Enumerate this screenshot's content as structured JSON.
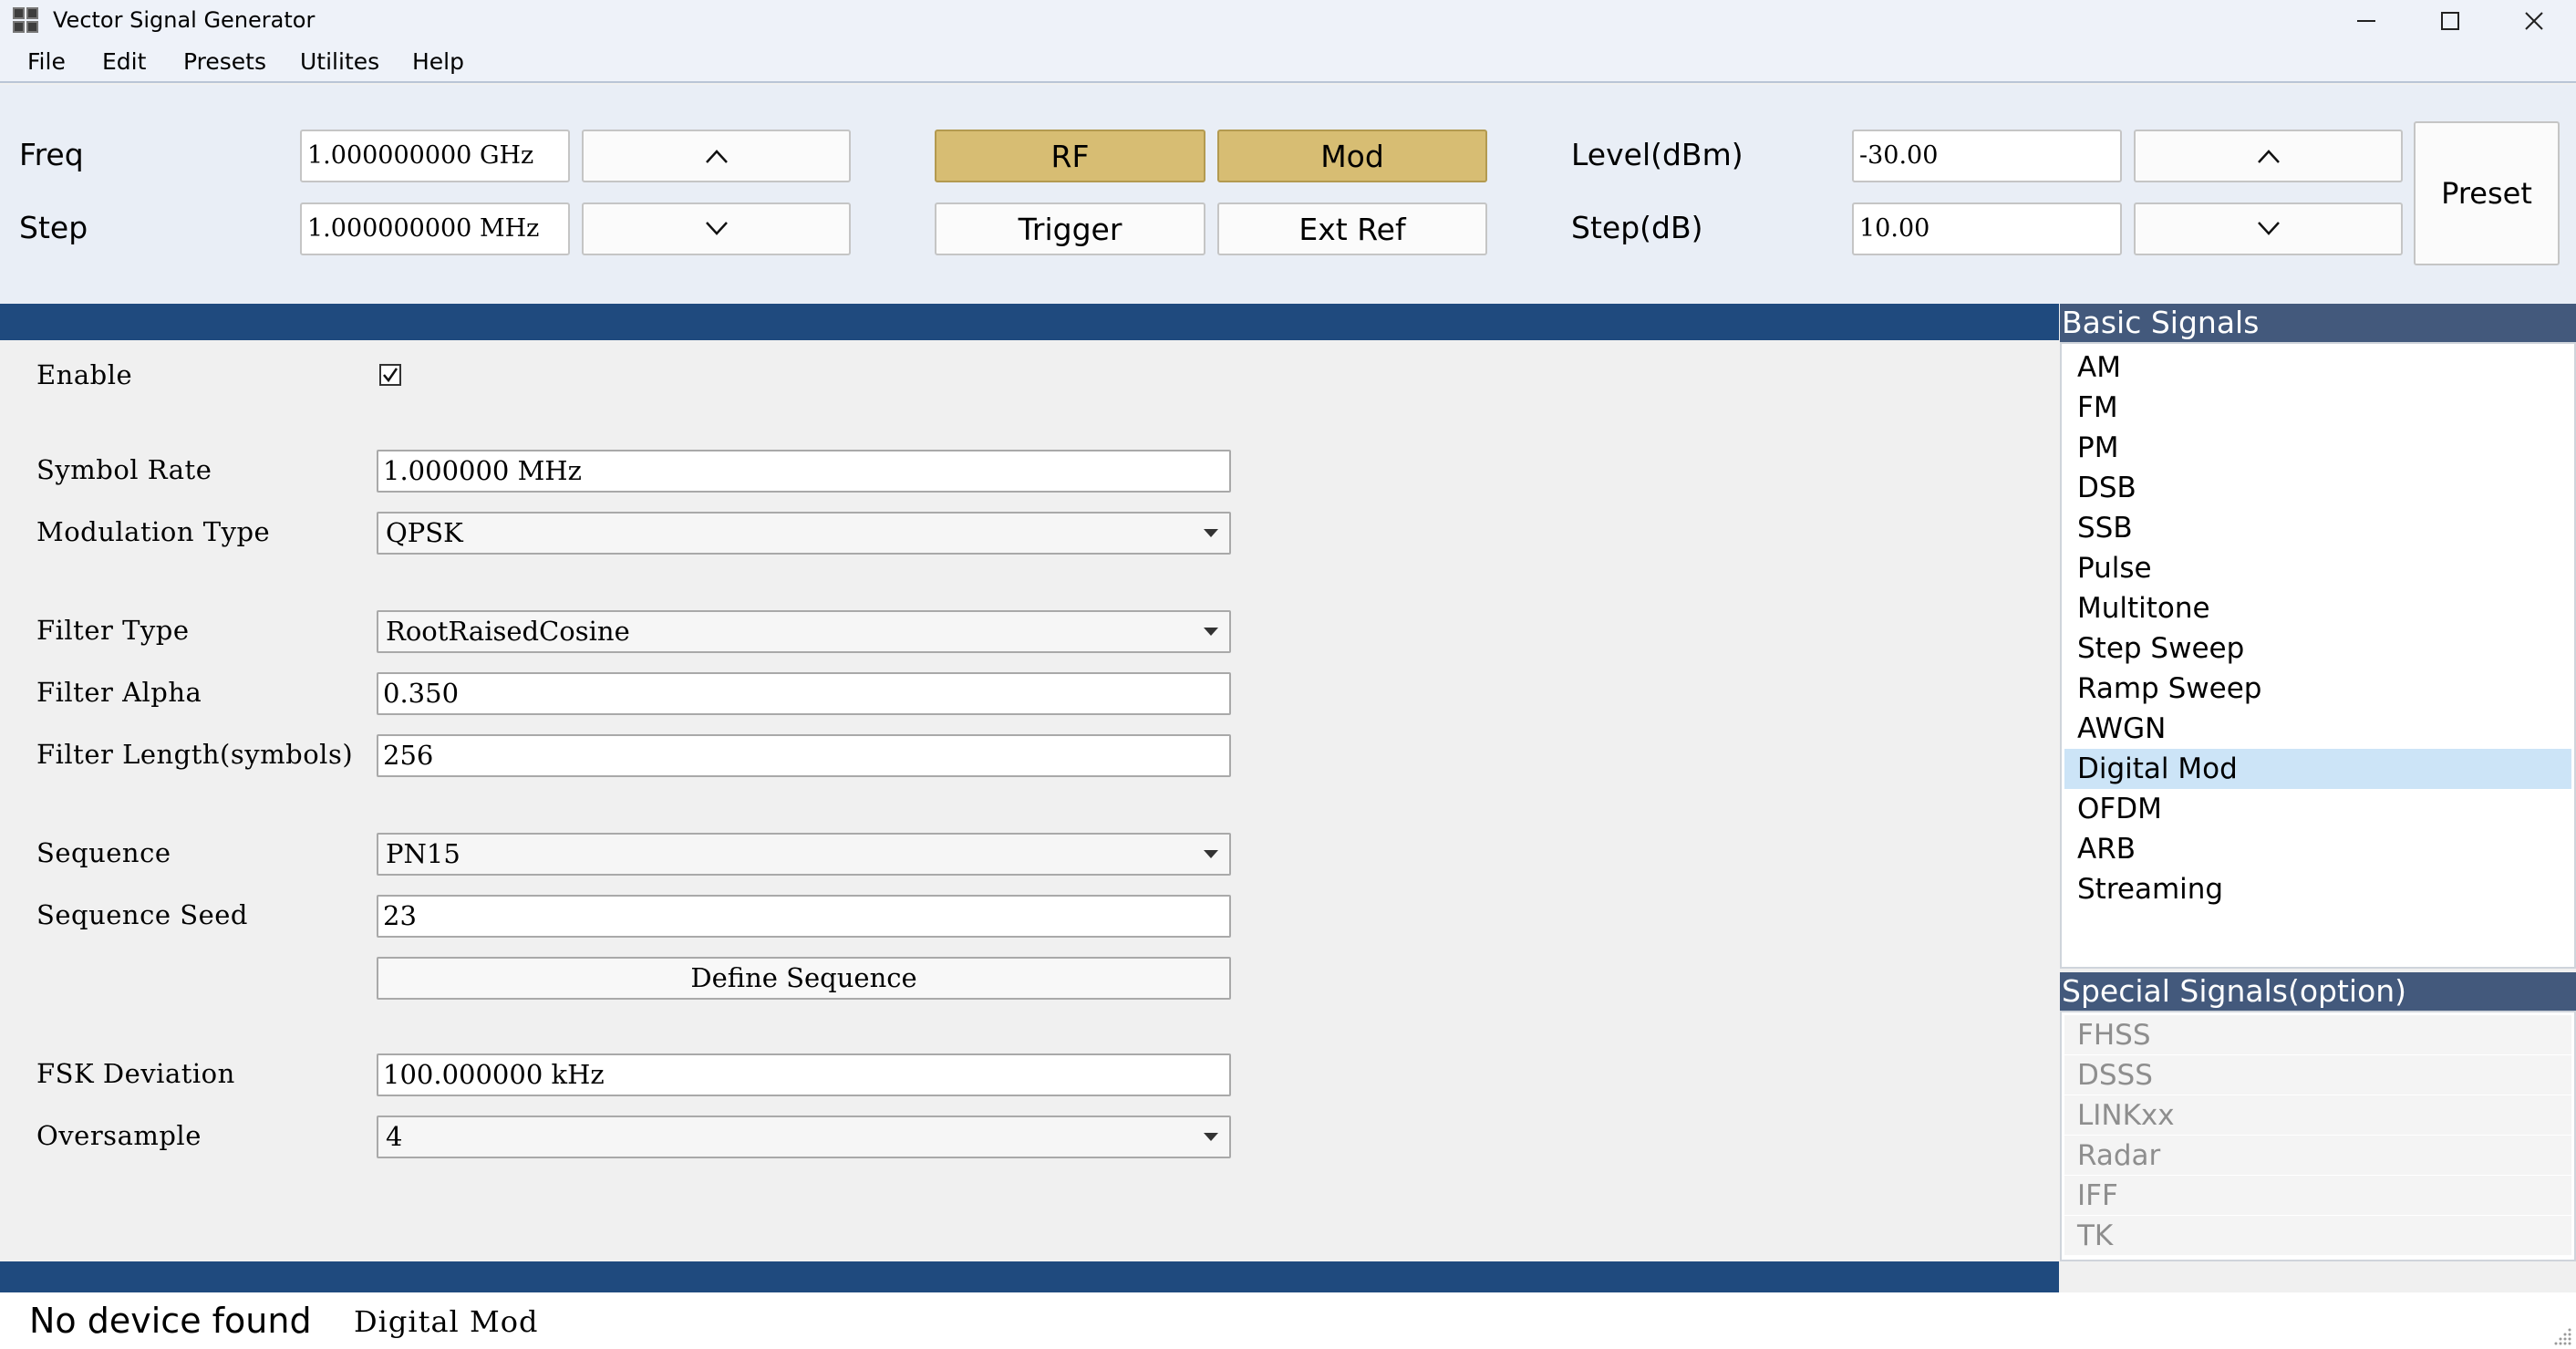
{
  "window": {
    "title": "Vector Signal Generator",
    "icon": "grid-app-icon"
  },
  "menu": [
    "File",
    "Edit",
    "Presets",
    "Utilites",
    "Help"
  ],
  "toolbar": {
    "freq_label": "Freq",
    "step_label": "Step",
    "freq_value": "1.000000000 GHz",
    "step_value": "1.000000000 MHz",
    "freq_up": "^",
    "freq_down": "v",
    "rf_label": "RF",
    "mod_label": "Mod",
    "trigger_label": "Trigger",
    "extref_label": "Ext Ref",
    "level_label": "Level(dBm)",
    "stepdb_label": "Step(dB)",
    "level_value": "-30.00",
    "stepdb_value": "10.00",
    "level_up": "^",
    "level_down": "v",
    "preset_label": "Preset",
    "active_color": "#d7bd73"
  },
  "form": {
    "enable_label": "Enable",
    "enable_checked": true,
    "symbol_rate_label": "Symbol Rate",
    "symbol_rate_value": "1.000000 MHz",
    "modulation_type_label": "Modulation Type",
    "modulation_type_value": "QPSK",
    "filter_type_label": "Filter Type",
    "filter_type_value": "RootRaisedCosine",
    "filter_alpha_label": "Filter Alpha",
    "filter_alpha_value": "0.350",
    "filter_length_label": "Filter Length(symbols)",
    "filter_length_value": "256",
    "sequence_label": "Sequence",
    "sequence_value": "PN15",
    "sequence_seed_label": "Sequence Seed",
    "sequence_seed_value": "23",
    "define_sequence_label": "Define Sequence",
    "fsk_deviation_label": "FSK Deviation",
    "fsk_deviation_value": "100.000000 kHz",
    "oversample_label": "Oversample",
    "oversample_value": "4"
  },
  "basic_signals": {
    "header": "Basic Signals",
    "items": [
      "AM",
      "FM",
      "PM",
      "DSB",
      "SSB",
      "Pulse",
      "Multitone",
      "Step Sweep",
      "Ramp Sweep",
      "AWGN",
      "Digital Mod",
      "OFDM",
      "ARB",
      "Streaming"
    ],
    "selected": "Digital Mod"
  },
  "special_signals": {
    "header": "Special Signals(option)",
    "items": [
      "FHSS",
      "DSSS",
      "LINKxx",
      "Radar",
      "IFF",
      "TK"
    ]
  },
  "status": {
    "device": "No device found",
    "mode": "Digital Mod"
  },
  "colors": {
    "bar_blue": "#1f4a7e",
    "panel_header": "#43597c",
    "selection": "#cce4f7"
  }
}
